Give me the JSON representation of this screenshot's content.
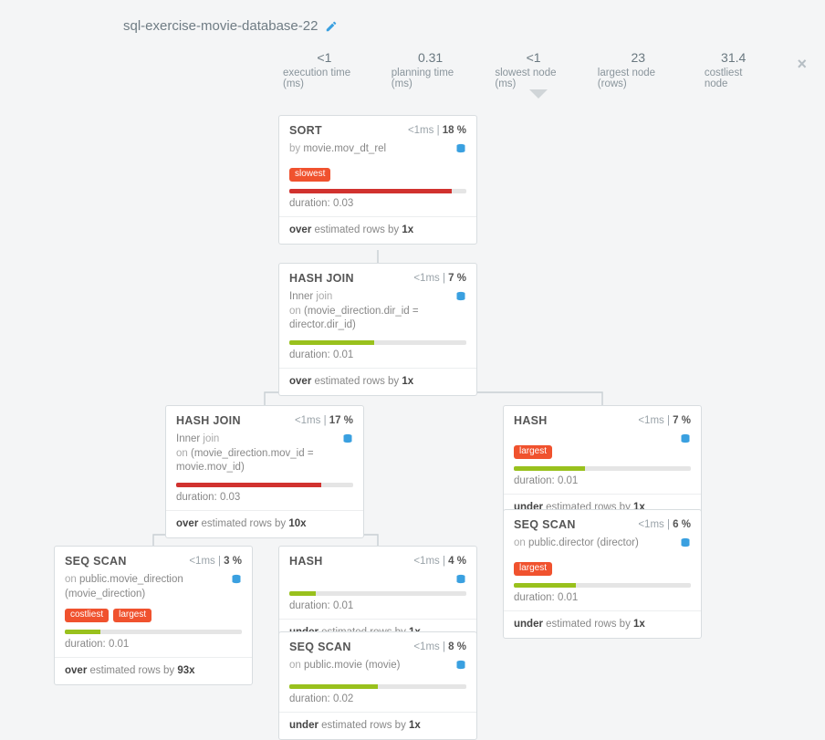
{
  "title": "sql-exercise-movie-database-22",
  "stats": {
    "exec_val": "<1",
    "exec_lbl": "execution time (ms)",
    "plan_val": "0.31",
    "plan_lbl": "planning time (ms)",
    "slow_val": "<1",
    "slow_lbl": "slowest node (ms)",
    "large_val": "23",
    "large_lbl": "largest node (rows)",
    "cost_val": "31.4",
    "cost_lbl": "costliest node"
  },
  "tags": {
    "slowest": "slowest",
    "largest": "largest",
    "costliest": "costliest"
  },
  "nodes": {
    "sort": {
      "type": "SORT",
      "meta_ms": "<1ms",
      "meta_sep": " | ",
      "meta_pct": "18 %",
      "sub_pre": "by ",
      "sub_val": "movie.mov_dt_rel",
      "dur": "duration: 0.03",
      "est_a": "over",
      "est_b": " estimated rows by ",
      "est_c": "1x"
    },
    "hj1": {
      "type": "HASH JOIN",
      "meta_ms": "<1ms",
      "meta_pct": "7 %",
      "sub_inner": "Inner",
      "sub_join": " join",
      "sub_on_pre": "on ",
      "sub_on_val": "(movie_direction.dir_id = director.dir_id)",
      "dur": "duration: 0.01",
      "est_a": "over",
      "est_b": " estimated rows by ",
      "est_c": "1x"
    },
    "hj2": {
      "type": "HASH JOIN",
      "meta_ms": "<1ms",
      "meta_pct": "17 %",
      "sub_inner": "Inner",
      "sub_join": " join",
      "sub_on_pre": "on ",
      "sub_on_val": "(movie_direction.mov_id = movie.mov_id)",
      "dur": "duration: 0.03",
      "est_a": "over",
      "est_b": " estimated rows by ",
      "est_c": "10x"
    },
    "hash1": {
      "type": "HASH",
      "meta_ms": "<1ms",
      "meta_pct": "7 %",
      "dur": "duration: 0.01",
      "est_a": "under",
      "est_b": " estimated rows by ",
      "est_c": "1x"
    },
    "ssdir": {
      "type": "SEQ SCAN",
      "meta_ms": "<1ms",
      "meta_pct": "6 %",
      "sub_pre": "on ",
      "sub_val": "public.director (director)",
      "dur": "duration: 0.01",
      "est_a": "under",
      "est_b": " estimated rows by ",
      "est_c": "1x"
    },
    "ssmd": {
      "type": "SEQ SCAN",
      "meta_ms": "<1ms",
      "meta_pct": "3 %",
      "sub_pre": "on ",
      "sub_val": "public.movie_direction (movie_direction)",
      "dur": "duration: 0.01",
      "est_a": "over",
      "est_b": " estimated rows by ",
      "est_c": "93x"
    },
    "hash2": {
      "type": "HASH",
      "meta_ms": "<1ms",
      "meta_pct": "4 %",
      "dur": "duration: 0.01",
      "est_a": "under",
      "est_b": " estimated rows by ",
      "est_c": "1x"
    },
    "ssmov": {
      "type": "SEQ SCAN",
      "meta_ms": "<1ms",
      "meta_pct": "8 %",
      "sub_pre": "on ",
      "sub_val": "public.movie (movie)",
      "dur": "duration: 0.02",
      "est_a": "under",
      "est_b": " estimated rows by ",
      "est_c": "1x"
    }
  }
}
